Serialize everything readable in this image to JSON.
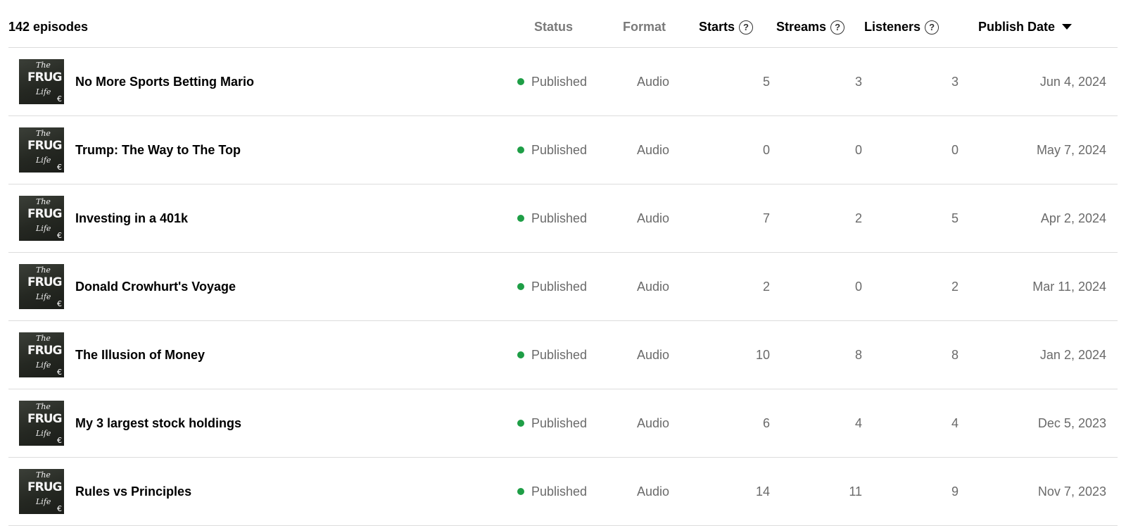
{
  "header": {
    "episode_count": "142 episodes",
    "status": "Status",
    "format": "Format",
    "starts": "Starts",
    "streams": "Streams",
    "listeners": "Listeners",
    "publish_date": "Publish Date",
    "help_glyph": "?"
  },
  "thumbnail": {
    "line1": "The",
    "line2": "FRUG",
    "line3": "Life",
    "symbol": "€"
  },
  "colors": {
    "published_dot": "#1e9e46",
    "muted_text": "#6a6a6a",
    "divider": "#dcdcdc"
  },
  "episodes": [
    {
      "title": "No More Sports Betting Mario",
      "status": "Published",
      "format": "Audio",
      "starts": "5",
      "streams": "3",
      "listeners": "3",
      "date": "Jun 4, 2024"
    },
    {
      "title": "Trump: The Way to The Top",
      "status": "Published",
      "format": "Audio",
      "starts": "0",
      "streams": "0",
      "listeners": "0",
      "date": "May 7, 2024"
    },
    {
      "title": "Investing in a 401k",
      "status": "Published",
      "format": "Audio",
      "starts": "7",
      "streams": "2",
      "listeners": "5",
      "date": "Apr 2, 2024"
    },
    {
      "title": "Donald Crowhurt's Voyage",
      "status": "Published",
      "format": "Audio",
      "starts": "2",
      "streams": "0",
      "listeners": "2",
      "date": "Mar 11, 2024"
    },
    {
      "title": "The Illusion of Money",
      "status": "Published",
      "format": "Audio",
      "starts": "10",
      "streams": "8",
      "listeners": "8",
      "date": "Jan 2, 2024"
    },
    {
      "title": "My 3 largest stock holdings",
      "status": "Published",
      "format": "Audio",
      "starts": "6",
      "streams": "4",
      "listeners": "4",
      "date": "Dec 5, 2023"
    },
    {
      "title": "Rules vs Principles",
      "status": "Published",
      "format": "Audio",
      "starts": "14",
      "streams": "11",
      "listeners": "9",
      "date": "Nov 7, 2023"
    }
  ]
}
